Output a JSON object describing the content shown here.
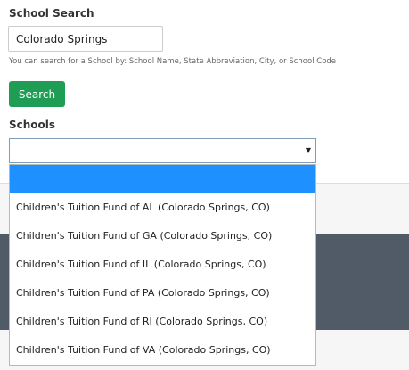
{
  "school_search": {
    "label": "School Search",
    "input_value": "Colorado Springs",
    "help_text": "You can search for a School by: School Name, State Abbreviation, City, or School Code",
    "search_button_label": "Search"
  },
  "schools": {
    "label": "Schools",
    "selected_value": "",
    "options": [
      "",
      "Children's Tuition Fund of AL (Colorado Springs, CO)",
      "Children's Tuition Fund of GA (Colorado Springs, CO)",
      "Children's Tuition Fund of IL (Colorado Springs, CO)",
      "Children's Tuition Fund of PA (Colorado Springs, CO)",
      "Children's Tuition Fund of RI (Colorado Springs, CO)",
      "Children's Tuition Fund of VA (Colorado Springs, CO)"
    ],
    "highlighted_index": 0
  },
  "colors": {
    "search_button": "#1f9d55",
    "option_highlight": "#1e90ff",
    "dark_band": "#515a67"
  }
}
